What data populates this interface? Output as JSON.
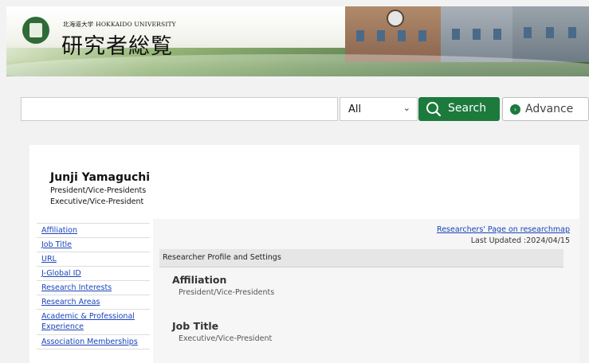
{
  "header": {
    "university_small": "北海道大学 HOKKAIDO UNIVERSITY",
    "site_title": "研究者総覧"
  },
  "search": {
    "input_value": "",
    "select_value": "All",
    "search_label": "Search",
    "advance_label": "Advance"
  },
  "profile": {
    "name": "Junji Yamaguchi",
    "position_lines": [
      "President/Vice-Presidents",
      "Executive/Vice-President"
    ]
  },
  "sidebar": {
    "items": [
      {
        "label": "Affiliation"
      },
      {
        "label": "Job Title"
      },
      {
        "label": "URL"
      },
      {
        "label": "J-Global ID"
      },
      {
        "label": "Research Interests"
      },
      {
        "label": "Research Areas"
      },
      {
        "label": "Academic & Professional Experience"
      },
      {
        "label": "Association Memberships"
      }
    ]
  },
  "main": {
    "researchmap_link": "Researchers' Page on researchmap",
    "last_updated": "Last Updated :2024/04/15",
    "section_title": "Researcher Profile and Settings",
    "affiliation_heading": "Affiliation",
    "affiliation_value": "President/Vice-Presidents",
    "job_title_heading": "Job Title",
    "job_title_value": "Executive/Vice-President"
  },
  "colors": {
    "brand_green": "#1c7a3d",
    "link_blue": "#1a44b8"
  }
}
